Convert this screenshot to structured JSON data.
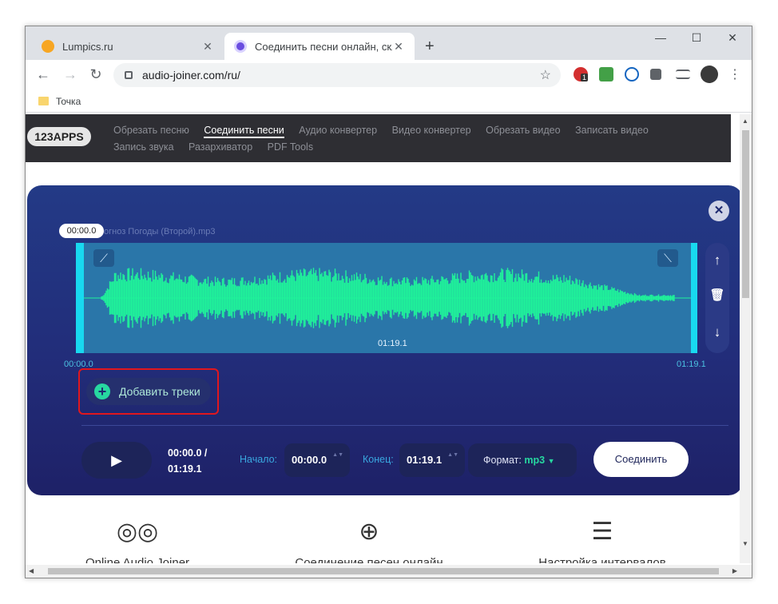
{
  "browser": {
    "tabs": [
      {
        "title": "Lumpics.ru",
        "favicon_color": "#f7a623",
        "active": false
      },
      {
        "title": "Соединить песни онлайн, склеи",
        "favicon_color": "#6a4de0",
        "active": true
      }
    ],
    "url": "audio-joiner.com/ru/",
    "bookmark": "Точка",
    "new_tab": "+",
    "win": {
      "minimize": "—",
      "maximize": "☐",
      "close": "✕"
    },
    "nav": {
      "back": "←",
      "forward": "→",
      "reload": "↻"
    },
    "badge": "1"
  },
  "site": {
    "logo": "123APPS",
    "nav_links": [
      {
        "label": "Обрезать песню",
        "selected": false
      },
      {
        "label": "Соединить песни",
        "selected": true
      },
      {
        "label": "Аудио конвертер",
        "selected": false
      },
      {
        "label": "Видео конвертер",
        "selected": false
      },
      {
        "label": "Обрезать видео",
        "selected": false
      },
      {
        "label": "Записать видео",
        "selected": false
      },
      {
        "label": "Запись звука",
        "selected": false
      },
      {
        "label": "Разархиватор",
        "selected": false
      },
      {
        "label": "PDF Tools",
        "selected": false
      }
    ]
  },
  "editor": {
    "close": "✕",
    "filename": "огноз Погоды (Второй).mp3",
    "cursor_time": "00:00.0",
    "track_duration": "01:19.1",
    "timeline_start": "00:00.0",
    "timeline_end": "01:19.1",
    "fade_in_icon": "⟋",
    "fade_out_icon": "⟍",
    "side": {
      "up": "↑",
      "delete": "🗑",
      "down": "↓"
    },
    "add_tracks": "Добавить треки",
    "add_icon": "+",
    "play_icon": "▶",
    "time_current": "00:00.0 /",
    "time_total": "01:19.1",
    "start_label": "Начало:",
    "start_value": "00:00.0",
    "end_label": "Конец:",
    "end_value": "01:19.1",
    "spinner": "▲▼",
    "format_label": "Формат:",
    "format_value": "mp3",
    "join_button": "Соединить",
    "wave_color": "#1ff29a"
  },
  "features": [
    {
      "icon": "◎◎",
      "label": "Online Audio Joiner"
    },
    {
      "icon": "⊕",
      "label": "Соединение песен онлайн"
    },
    {
      "icon": "☰",
      "label": "Настройка интервалов"
    }
  ]
}
